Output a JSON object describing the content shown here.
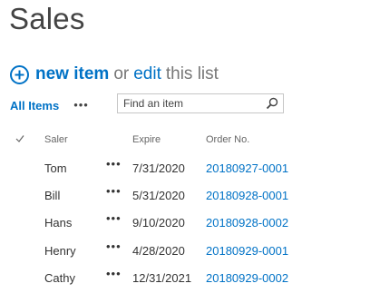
{
  "page": {
    "title": "Sales"
  },
  "command_bar": {
    "new_item": "new item",
    "or": "or",
    "edit": "edit",
    "this_list": "this list"
  },
  "views": {
    "current": "All Items",
    "more": "•••"
  },
  "search": {
    "placeholder": "Find an item",
    "value": ""
  },
  "columns": {
    "saler": "Saler",
    "expire": "Expire",
    "order_no": "Order No."
  },
  "rows": [
    {
      "saler": "Tom",
      "menu": "•••",
      "expire": "7/31/2020",
      "order_no": "20180927-0001"
    },
    {
      "saler": "Bill",
      "menu": "•••",
      "expire": "5/31/2020",
      "order_no": "20180928-0001"
    },
    {
      "saler": "Hans",
      "menu": "•••",
      "expire": "9/10/2020",
      "order_no": "20180928-0002"
    },
    {
      "saler": "Henry",
      "menu": "•••",
      "expire": "4/28/2020",
      "order_no": "20180929-0001"
    },
    {
      "saler": "Cathy",
      "menu": "•••",
      "expire": "12/31/2021",
      "order_no": "20180929-0002"
    }
  ],
  "colors": {
    "link": "#0072c6",
    "muted": "#777777",
    "text": "#333333"
  }
}
